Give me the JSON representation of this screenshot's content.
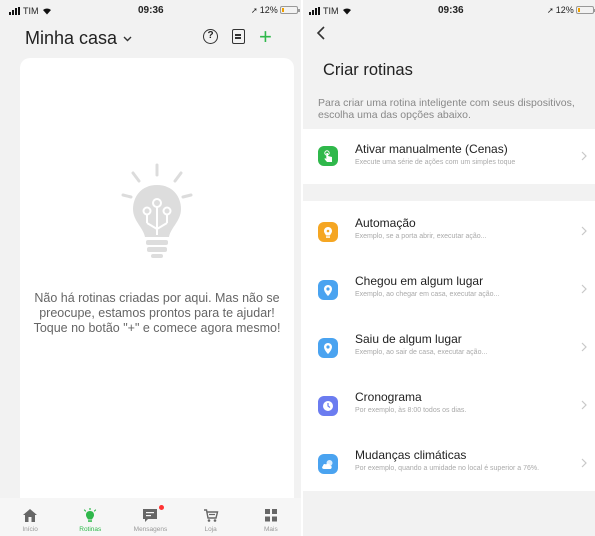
{
  "left": {
    "status": {
      "carrier": "TIM",
      "time": "09:36",
      "battery": "12%"
    },
    "header": {
      "title": "Minha casa"
    },
    "empty_message": "Não há rotinas criadas por aqui. Mas não se preocupe, estamos prontos para te ajudar! Toque no botão \"+\" e comece agora mesmo!",
    "tabs": [
      {
        "label": "Início",
        "icon": "home-icon"
      },
      {
        "label": "Rotinas",
        "icon": "bulb-icon",
        "active": true
      },
      {
        "label": "Mensagens",
        "icon": "message-icon",
        "badge": true
      },
      {
        "label": "Loja",
        "icon": "cart-icon"
      },
      {
        "label": "Mais",
        "icon": "grid-icon"
      }
    ]
  },
  "right": {
    "status": {
      "carrier": "TIM",
      "time": "09:36",
      "battery": "12%"
    },
    "title": "Criar rotinas",
    "subtitle": "Para criar uma rotina inteligente com seus dispositivos, escolha uma das opções abaixo.",
    "manual": {
      "title": "Ativar manualmente (Cenas)",
      "desc": "Execute uma série de ações com um simples toque",
      "icon": "tap-icon",
      "color": "#2fb84b"
    },
    "options": [
      {
        "title": "Automação",
        "desc": "Exemplo, se a porta abrir, executar ação...",
        "icon": "bulb-icon",
        "color": "#f5a623"
      },
      {
        "title": "Chegou em algum lugar",
        "desc": "Exemplo, ao chegar em casa, executar ação...",
        "icon": "location-icon",
        "color": "#4aa3f0"
      },
      {
        "title": "Saiu de algum lugar",
        "desc": "Exemplo, ao sair de casa, executar ação...",
        "icon": "location-icon",
        "color": "#4aa3f0"
      },
      {
        "title": "Cronograma",
        "desc": "Por exemplo, às 8:00 todos os dias.",
        "icon": "clock-icon",
        "color": "#6b7cf0"
      },
      {
        "title": "Mudanças climáticas",
        "desc": "Por exemplo, quando a umidade no local é superior a 76%.",
        "icon": "weather-icon",
        "color": "#4aa3f0"
      }
    ]
  },
  "colors": {
    "accent": "#2fb84b",
    "badge": "#ff3333"
  }
}
